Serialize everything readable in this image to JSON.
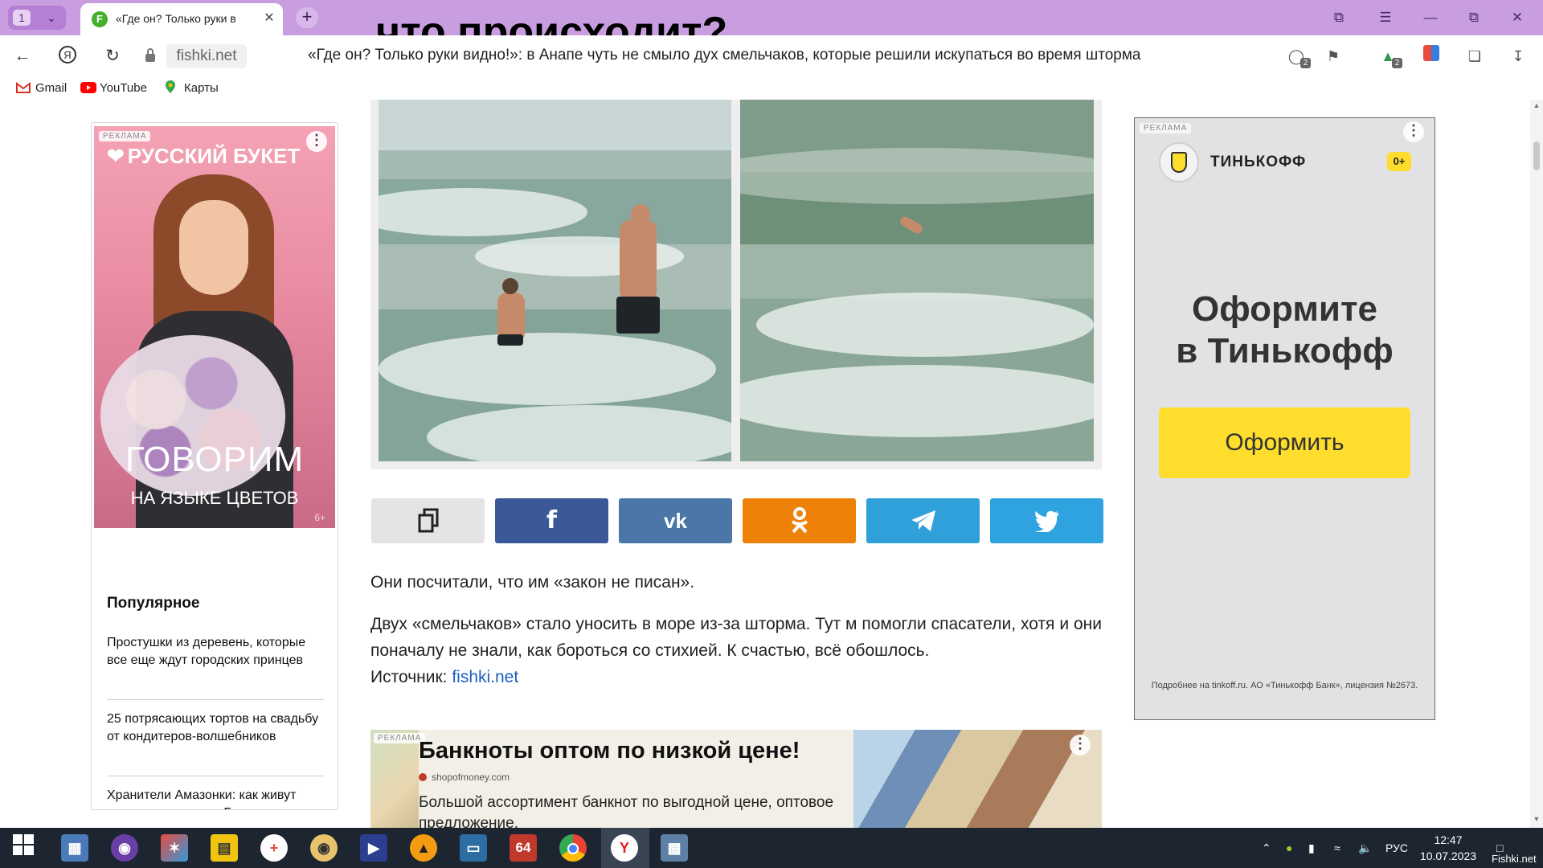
{
  "browser": {
    "tab_count": "1",
    "tab_title": "«Где он? Только руки в",
    "tab_favicon_letter": "F",
    "overlay_caption": "что происходит?",
    "domain": "fishki.net",
    "page_heading": "«Где он? Только руки видно!»: в Анапе чуть не смыло дух смельчаков, которые решили искупаться во время шторма",
    "toolbar_badges": {
      "protect": "2",
      "shield": "2"
    }
  },
  "bookmarks": [
    {
      "label": "Gmail",
      "icon": "gmail-icon"
    },
    {
      "label": "YouTube",
      "icon": "youtube-icon"
    },
    {
      "label": "Карты",
      "icon": "maps-pin-icon"
    }
  ],
  "left_ad": {
    "label": "РЕКЛАМА",
    "brand": "РУССКИЙ БУКЕТ",
    "cta_line1": "ГОВОРИМ",
    "cta_line2": "НА ЯЗЫКЕ ЦВЕТОВ",
    "age": "6+"
  },
  "popular": {
    "heading": "Популярное",
    "items": [
      "Простушки из деревень, которые все еще ждут городских принцев",
      "25 потрясающих тортов на свадьбу от кондитеров-волшебников",
      "Хранители Амазонки: как живут коренные племена Бразилии сегодня"
    ]
  },
  "share": [
    {
      "name": "copy",
      "label": "",
      "color": "#e4e4e4"
    },
    {
      "name": "facebook",
      "label": "f",
      "color": "#3b5998"
    },
    {
      "name": "vk",
      "label": "vk",
      "color": "#4a76a8"
    },
    {
      "name": "odnoklassniki",
      "label": "ok",
      "color": "#ee8208"
    },
    {
      "name": "telegram",
      "label": "tg",
      "color": "#2fa0da"
    },
    {
      "name": "twitter",
      "label": "tw",
      "color": "#2fa3e0"
    }
  ],
  "article": {
    "p1": "Они посчитали, что им «закон не писан».",
    "p2": "Двух «смельчаков» стало уносить в море из-за шторма. Тут м помогли спасатели, хотя и они поначалу не знали, как бороться со стихией. К счастью, всё обошлось.",
    "source_label": "Источник: ",
    "source_link": "fishki.net"
  },
  "bottom_ad": {
    "label": "РЕКЛАМА",
    "title": "Банкноты оптом по низкой цене!",
    "domain": "shopofmoney.com",
    "description": "Большой ассортимент банкнот по выгодной цене, оптовое предложение."
  },
  "right_ad": {
    "label": "РЕКЛАМА",
    "brand": "ТИНЬКОФФ",
    "age": "0+",
    "headline_line1": "Оформите",
    "headline_line2": "в Тинькофф",
    "button": "Оформить",
    "legal": "Подробнее на tinkoff.ru. АО «Тинькофф Банк», лицензия №2673."
  },
  "taskbar": {
    "lang": "РУС",
    "time": "12:47",
    "date": "10.07.2023",
    "watermark": "Fishki.net",
    "apps": [
      "file-manager-icon",
      "globe-icon",
      "colorful-app-icon",
      "notepad-icon",
      "medical-cross-icon",
      "eye-app-icon",
      "video-icon",
      "triangle-app-icon",
      "monitor-app-icon",
      "64-app-icon",
      "chrome-icon",
      "yandex-browser-icon",
      "remote-desktop-icon"
    ]
  },
  "colors": {
    "tabstrip": "#c89ee0",
    "link": "#1b5fc1",
    "tinkoff_yellow": "#ffdd2d",
    "taskbar": "#1c2530"
  }
}
